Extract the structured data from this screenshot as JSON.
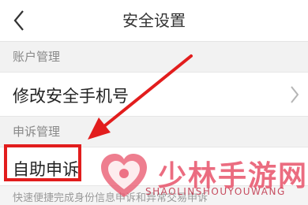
{
  "nav": {
    "title": "安全设置"
  },
  "sections": [
    {
      "header": "账户管理",
      "items": [
        {
          "label": "修改安全手机号"
        }
      ]
    },
    {
      "header": "申诉管理",
      "items": [
        {
          "label": "自助申诉"
        }
      ]
    }
  ],
  "appeal_desc": "快速便捷完成身份信息申诉和异常交易申诉",
  "watermark": {
    "name": "少林手游网",
    "pinyin": "SHAOLINSHOUYOUWANG"
  },
  "colors": {
    "highlight": "#e21d1d",
    "watermark": "#e8536a"
  }
}
